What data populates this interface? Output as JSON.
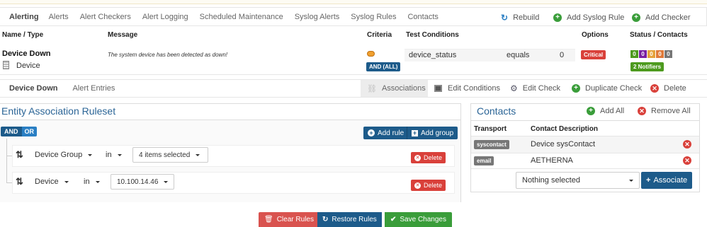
{
  "nav": {
    "title": "Alerting",
    "links": [
      "Alerts",
      "Alert Checkers",
      "Alert Logging",
      "Scheduled Maintenance",
      "Syslog Alerts",
      "Syslog Rules",
      "Contacts"
    ],
    "rebuild": "Rebuild",
    "add_syslog_rule": "Add Syslog Rule",
    "add_checker": "Add Checker"
  },
  "table": {
    "headers": {
      "name": "Name / Type",
      "message": "Message",
      "criteria": "Criteria",
      "test": "Test Conditions",
      "options": "Options",
      "status": "Status / Contacts"
    },
    "row": {
      "name": "Device Down",
      "type": "Device",
      "message": "The system device has been detected as down!",
      "criteria_label": "AND (ALL)",
      "cond_field": "device_status",
      "cond_op": "equals",
      "cond_value": "0",
      "option": "Critical",
      "status_counts": [
        "0",
        "0",
        "0",
        "0",
        "0"
      ],
      "status_colors": [
        "#4d9a1e",
        "#7b1fa2",
        "#e6a23c",
        "#e07a3a",
        "#777777"
      ],
      "notifiers": "2 Notifiers"
    }
  },
  "subnav": {
    "title": "Device Down",
    "alert_entries": "Alert Entries",
    "associations": "Associations",
    "edit_conditions": "Edit Conditions",
    "edit_check": "Edit Check",
    "duplicate_check": "Duplicate Check",
    "delete": "Delete"
  },
  "ruleset": {
    "title": "Entity Association Ruleset",
    "and": "AND",
    "or": "OR",
    "add_rule": "Add rule",
    "add_group": "Add group",
    "rules": [
      {
        "field": "Device Group",
        "op": "in",
        "value": "4 items selected",
        "delete": "Delete"
      },
      {
        "field": "Device",
        "op": "in",
        "value": "10.100.14.46",
        "delete": "Delete"
      }
    ],
    "clear": "Clear Rules",
    "restore": "Restore Rules",
    "save": "Save Changes"
  },
  "contacts": {
    "title": "Contacts",
    "add_all": "Add All",
    "remove_all": "Remove All",
    "col_transport": "Transport",
    "col_desc": "Contact Description",
    "rows": [
      {
        "transport": "syscontact",
        "desc": "Device sysContact"
      },
      {
        "transport": "email",
        "desc": "AETHERNA"
      }
    ],
    "select_placeholder": "Nothing selected",
    "associate": "Associate"
  },
  "colors": {
    "accent": "#2a6496",
    "green": "#3a9d3a",
    "red": "#d9403a",
    "navy": "#1d5b8a"
  }
}
